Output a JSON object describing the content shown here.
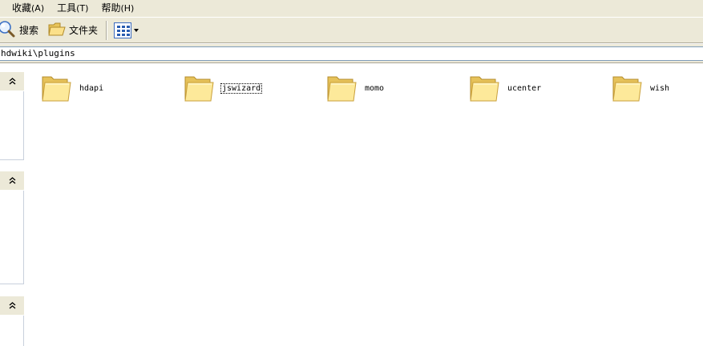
{
  "menubar": {
    "items": [
      {
        "label": "收藏",
        "accel": "(A)"
      },
      {
        "label": "工具",
        "accel": "(T)"
      },
      {
        "label": "帮助",
        "accel": "(H)"
      }
    ]
  },
  "toolbar": {
    "search_label": "搜索",
    "folders_label": "文件夹",
    "search_icon": "search-icon",
    "folders_icon": "folders-icon",
    "views_icon": "views-icon"
  },
  "address": {
    "value": "hdwiki\\plugins"
  },
  "taskpane": {
    "sections": [
      {
        "icon": "collapse-chevron-up-icon"
      },
      {
        "icon": "collapse-chevron-up-icon"
      },
      {
        "icon": "collapse-chevron-up-icon"
      }
    ]
  },
  "files": [
    {
      "name": "hdapi",
      "icon": "folder-icon"
    },
    {
      "name": "jswizard",
      "icon": "folder-icon",
      "focused": true
    },
    {
      "name": "momo",
      "icon": "folder-icon"
    },
    {
      "name": "ucenter",
      "icon": "folder-icon"
    },
    {
      "name": "wish",
      "icon": "folder-icon"
    }
  ],
  "colors": {
    "chrome": "#ece9d8",
    "folder_light": "#fde99a",
    "folder_dark": "#e0b94a",
    "accent": "#2a5db0"
  }
}
